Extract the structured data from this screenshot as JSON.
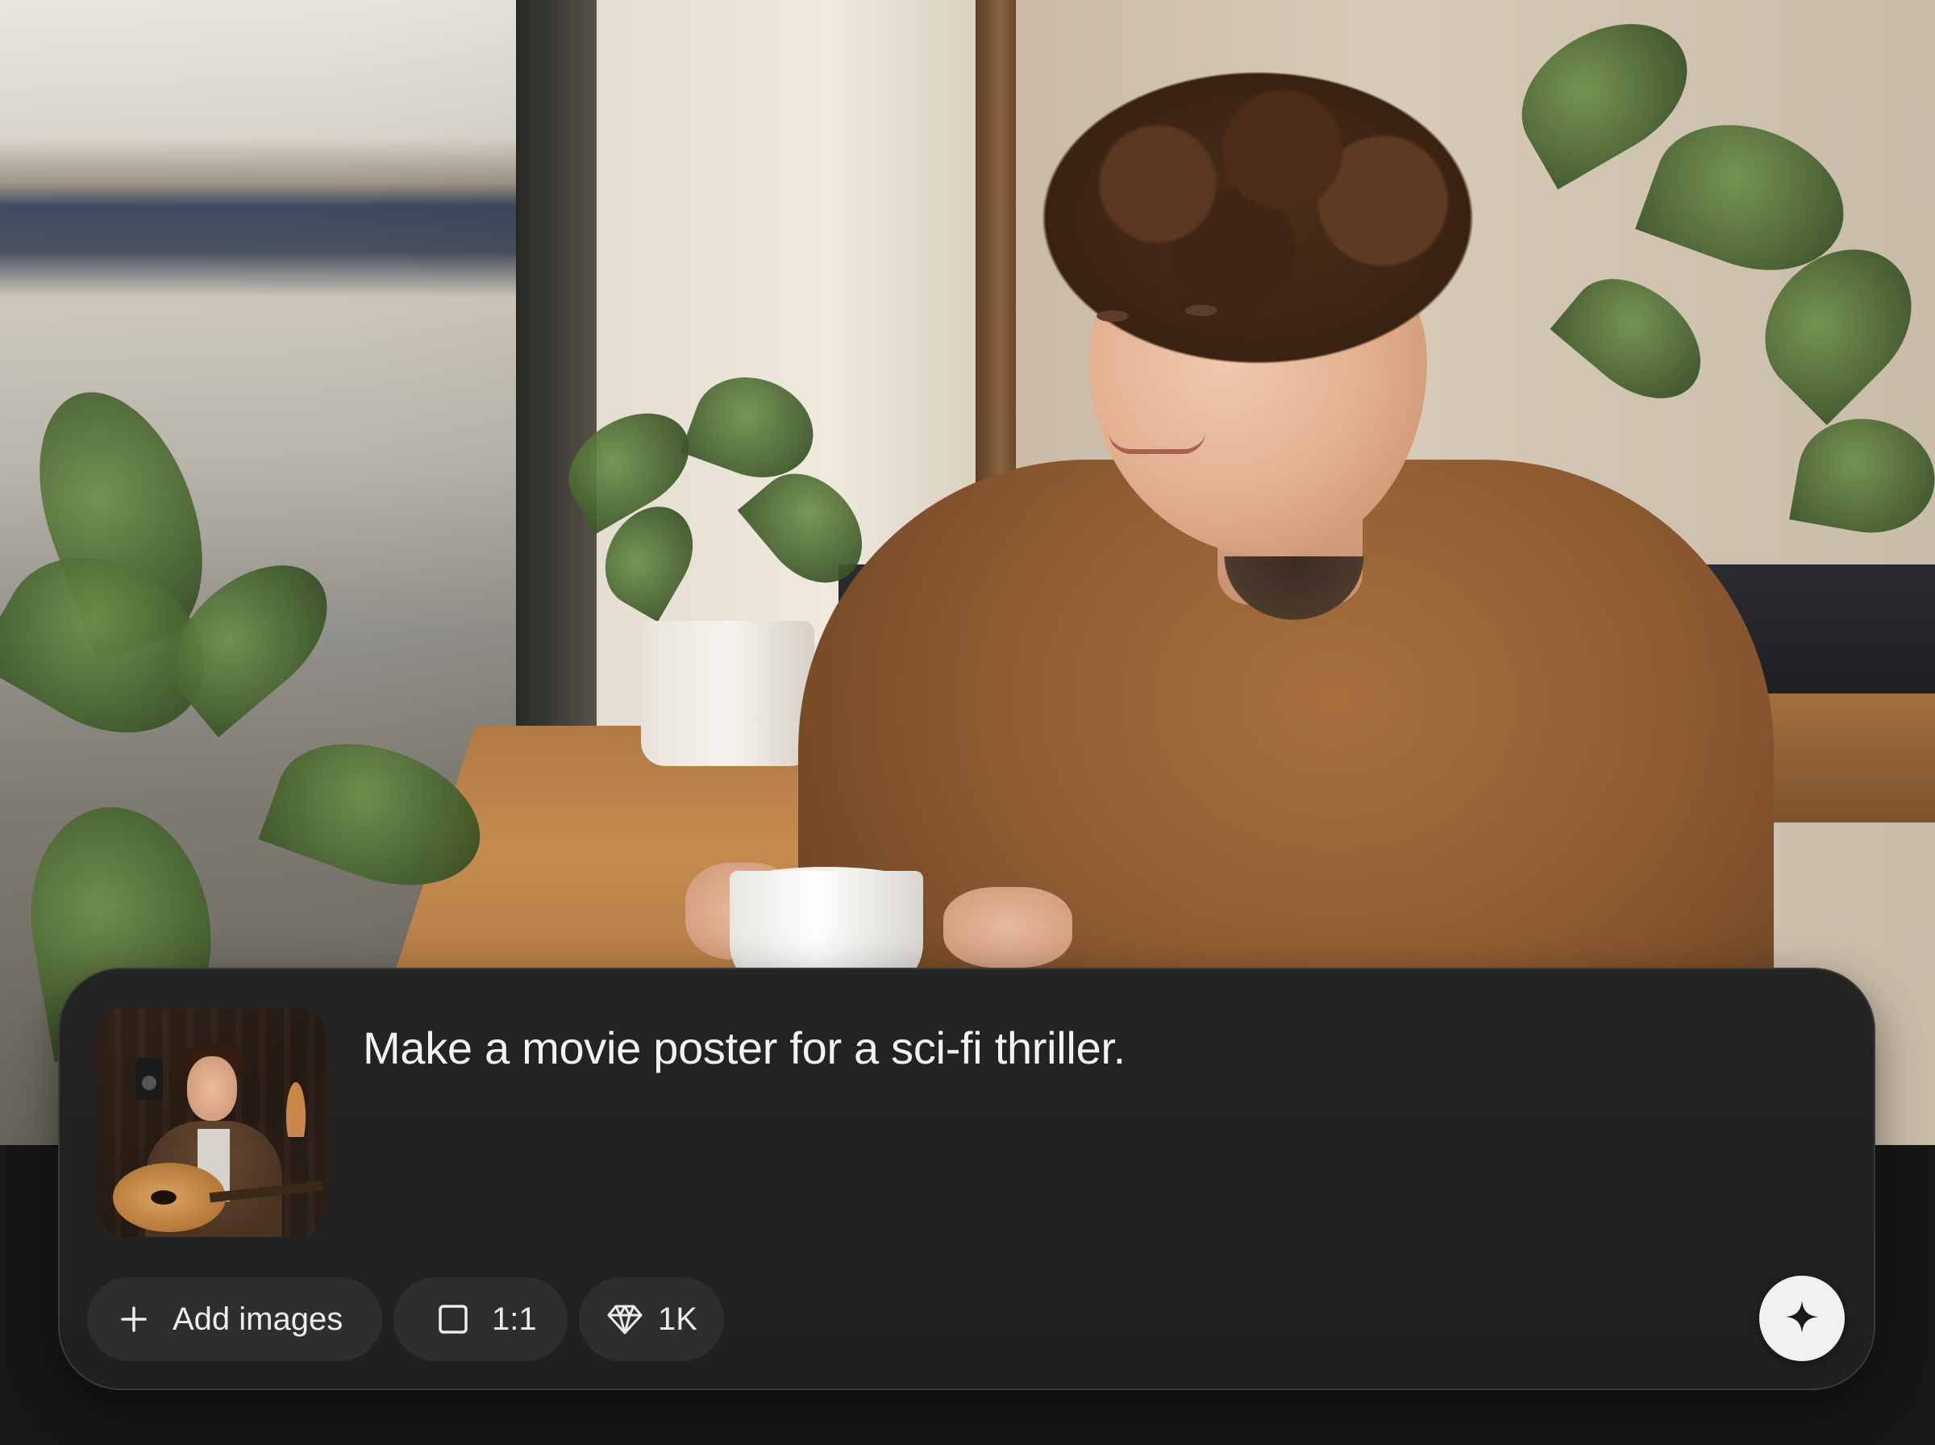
{
  "prompt": {
    "text": "Make a movie poster for a sci-fi thriller."
  },
  "attachment": {
    "thumbnail_icon": "reference-image-thumbnail"
  },
  "toolbar": {
    "add_images_label": "Add images",
    "aspect_ratio_label": "1:1",
    "resolution_label": "1K"
  },
  "icons": {
    "add": "plus-icon",
    "aspect_ratio": "square-icon",
    "resolution": "diamond-icon",
    "send": "sparkle-icon"
  },
  "colors": {
    "panel_bg": "#222222",
    "chip_bg": "#2e2e2e",
    "send_bg": "#f1f1f1",
    "text": "#f2f2f2"
  }
}
